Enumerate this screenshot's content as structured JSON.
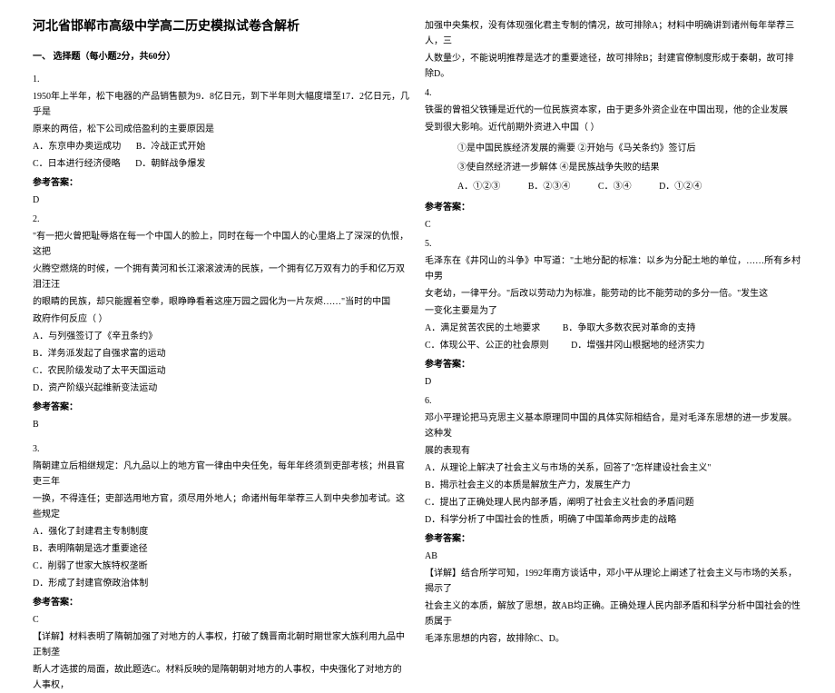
{
  "title": "河北省邯郸市高级中学高二历史模拟试卷含解析",
  "section1": "一、 选择题（每小题2分，共60分）",
  "q1": {
    "num": "1.",
    "stem1": "1950年上半年，松下电器的产品销售额为9．8亿日元，到下半年则大幅度增至17．2亿日元，几乎是",
    "stem2": "原来的两倍，松下公司成倍盈利的主要原因是",
    "a": "A．东京申办奥运成功",
    "b": "B．冷战正式开始",
    "c": "C．日本进行经济侵略",
    "d": "D．朝鲜战争爆发",
    "ansLabel": "参考答案：",
    "ans": "D"
  },
  "q2": {
    "num": "2.",
    "stem1": "\"有一把火曾把耻辱烙在每一个中国人的脸上，同时在每一个中国人的心里烙上了深深的仇恨，这把",
    "stem2": "火腾空燃烧的时候，一个拥有黄河和长江滚滚波涛的民族，一个拥有亿万双有力的手和亿万双泪汪汪",
    "stem3": "的眼睛的民族，却只能握着空拳，眼睁睁看着这座万园之园化为一片灰烬……\"当时的中国",
    "stem4": "政府作何反应（    ）",
    "a": "A．与列强签订了《辛丑条约》",
    "b": "B．洋务派发起了自强求富的运动",
    "c": "C．农民阶级发动了太平天国运动",
    "d": "D．资产阶级兴起维新变法运动",
    "ansLabel": "参考答案：",
    "ans": "B"
  },
  "q3": {
    "num": "3.",
    "stem1": "隋朝建立后相继规定：凡九品以上的地方官一律由中央任免，每年年终须到吏部考核；州县官吏三年",
    "stem2": "一换，不得连任；吏部选用地方官，须尽用外地人；命诸州每年举荐三人到中央参加考试。这些规定",
    "a": "A．强化了封建君主专制制度",
    "b": "B．表明隋朝是选才重要途径",
    "c": "C．削弱了世家大族特权垄断",
    "d": "D．形成了封建官僚政治体制",
    "ansLabel": "参考答案：",
    "ans": "C",
    "exp1": "【详解】材料表明了隋朝加强了对地方的人事权，打破了魏晋南北朝时期世家大族利用九品中正制垄",
    "exp2": "断人才选拔的局面，故此题选C。材料反映的是隋朝朝对地方的人事权，中央强化了对地方的人事权，"
  },
  "right_top": {
    "l1": "加强中央集权，没有体现强化君主专制的情况，故可排除A；材料中明确讲到诸州每年举荐三人，三",
    "l2": "人数量少，不能说明推荐是选才的重要途径，故可排除B；封建官僚制度形成于秦朝，故可排除D。"
  },
  "q4": {
    "num": "4.",
    "stem1": "铁蛋的曾祖父铁锤是近代的一位民族资本家，由于更多外资企业在中国出现，他的企业发展",
    "stem2": "受到很大影响。近代前期外资进入中国（    ）",
    "i1": "①是中国民族经济发展的需要    ②开始与《马关条约》签订后",
    "i2": "③使自然经济进一步解体        ④是民族战争失败的结果",
    "a": "A．①②③",
    "b": "B．②③④",
    "c": "C．③④",
    "d": "D．①②④",
    "ansLabel": "参考答案：",
    "ans": "C"
  },
  "q5": {
    "num": "5.",
    "stem1": "毛泽东在《井冈山的斗争》中写道：\"土地分配的标准：以乡为分配土地的单位，……所有乡村中男",
    "stem2": "女老幼，一律平分。\"后改以劳动力为标准，能劳动的比不能劳动的多分一倍。\"发生这",
    "stem3": "一变化主要是为了",
    "a": "A．满足贫苦农民的土地要求",
    "b": "B．争取大多数农民对革命的支持",
    "c": "C．体现公平、公正的社会原则",
    "d": "D．增强井冈山根据地的经济实力",
    "ansLabel": "参考答案：",
    "ans": "D"
  },
  "q6": {
    "num": "6.",
    "stem1": "邓小平理论把马克思主义基本原理同中国的具体实际相结合，是对毛泽东思想的进一步发展。这种发",
    "stem2": "展的表现有",
    "a": "A．从理论上解决了社会主义与市场的关系，回答了\"怎样建设社会主义\"",
    "b": "B．揭示社会主义的本质是解放生产力，发展生产力",
    "c": "C．提出了正确处理人民内部矛盾，阐明了社会主义社会的矛盾问题",
    "d": "D．科学分析了中国社会的性质，明确了中国革命两步走的战略",
    "ansLabel": "参考答案：",
    "ans": "AB",
    "exp1": "【详解】结合所学可知，1992年南方谈话中，邓小平从理论上阐述了社会主义与市场的关系，揭示了",
    "exp2": "社会主义的本质，解放了思想，故AB均正确。正确处理人民内部矛盾和科学分析中国社会的性质属于",
    "exp3": "毛泽东思想的内容，故排除C、D。"
  }
}
